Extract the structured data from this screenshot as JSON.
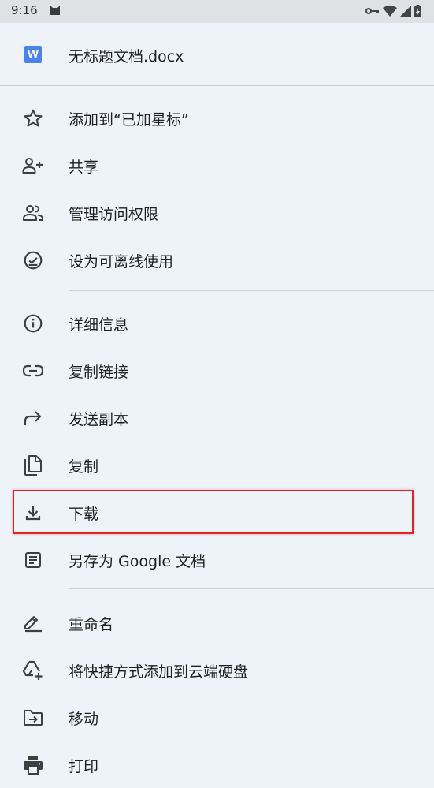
{
  "status_bar": {
    "time": "9:16"
  },
  "document": {
    "logo_letter": "W",
    "title": "无标题文档.docx"
  },
  "menu": {
    "items": [
      {
        "id": "star",
        "label": "添加到“已加星标”",
        "icon": "star-outline-icon"
      },
      {
        "id": "share",
        "label": "共享",
        "icon": "person-add-icon"
      },
      {
        "id": "manage-access",
        "label": "管理访问权限",
        "icon": "people-icon"
      },
      {
        "id": "offline",
        "label": "设为可离线使用",
        "icon": "offline-check-icon"
      },
      {
        "id": "details",
        "label": "详细信息",
        "icon": "info-icon"
      },
      {
        "id": "copy-link",
        "label": "复制链接",
        "icon": "link-icon"
      },
      {
        "id": "send-copy",
        "label": "发送副本",
        "icon": "forward-arrow-icon"
      },
      {
        "id": "make-copy",
        "label": "复制",
        "icon": "copy-icon"
      },
      {
        "id": "download",
        "label": "下载",
        "icon": "download-icon"
      },
      {
        "id": "save-as-docs",
        "label": "另存为 Google 文档",
        "icon": "document-icon"
      },
      {
        "id": "rename",
        "label": "重命名",
        "icon": "pencil-icon"
      },
      {
        "id": "add-shortcut",
        "label": "将快捷方式添加到云端硬盘",
        "icon": "drive-shortcut-icon"
      },
      {
        "id": "move",
        "label": "移动",
        "icon": "folder-move-icon"
      },
      {
        "id": "print",
        "label": "打印",
        "icon": "printer-icon"
      }
    ]
  },
  "colors": {
    "sheet_background": "#eef3fa",
    "status_bar": "#dfe1e5",
    "doc_logo": "#4a84e8",
    "highlight": "#e02424",
    "icon": "#3c4043"
  }
}
